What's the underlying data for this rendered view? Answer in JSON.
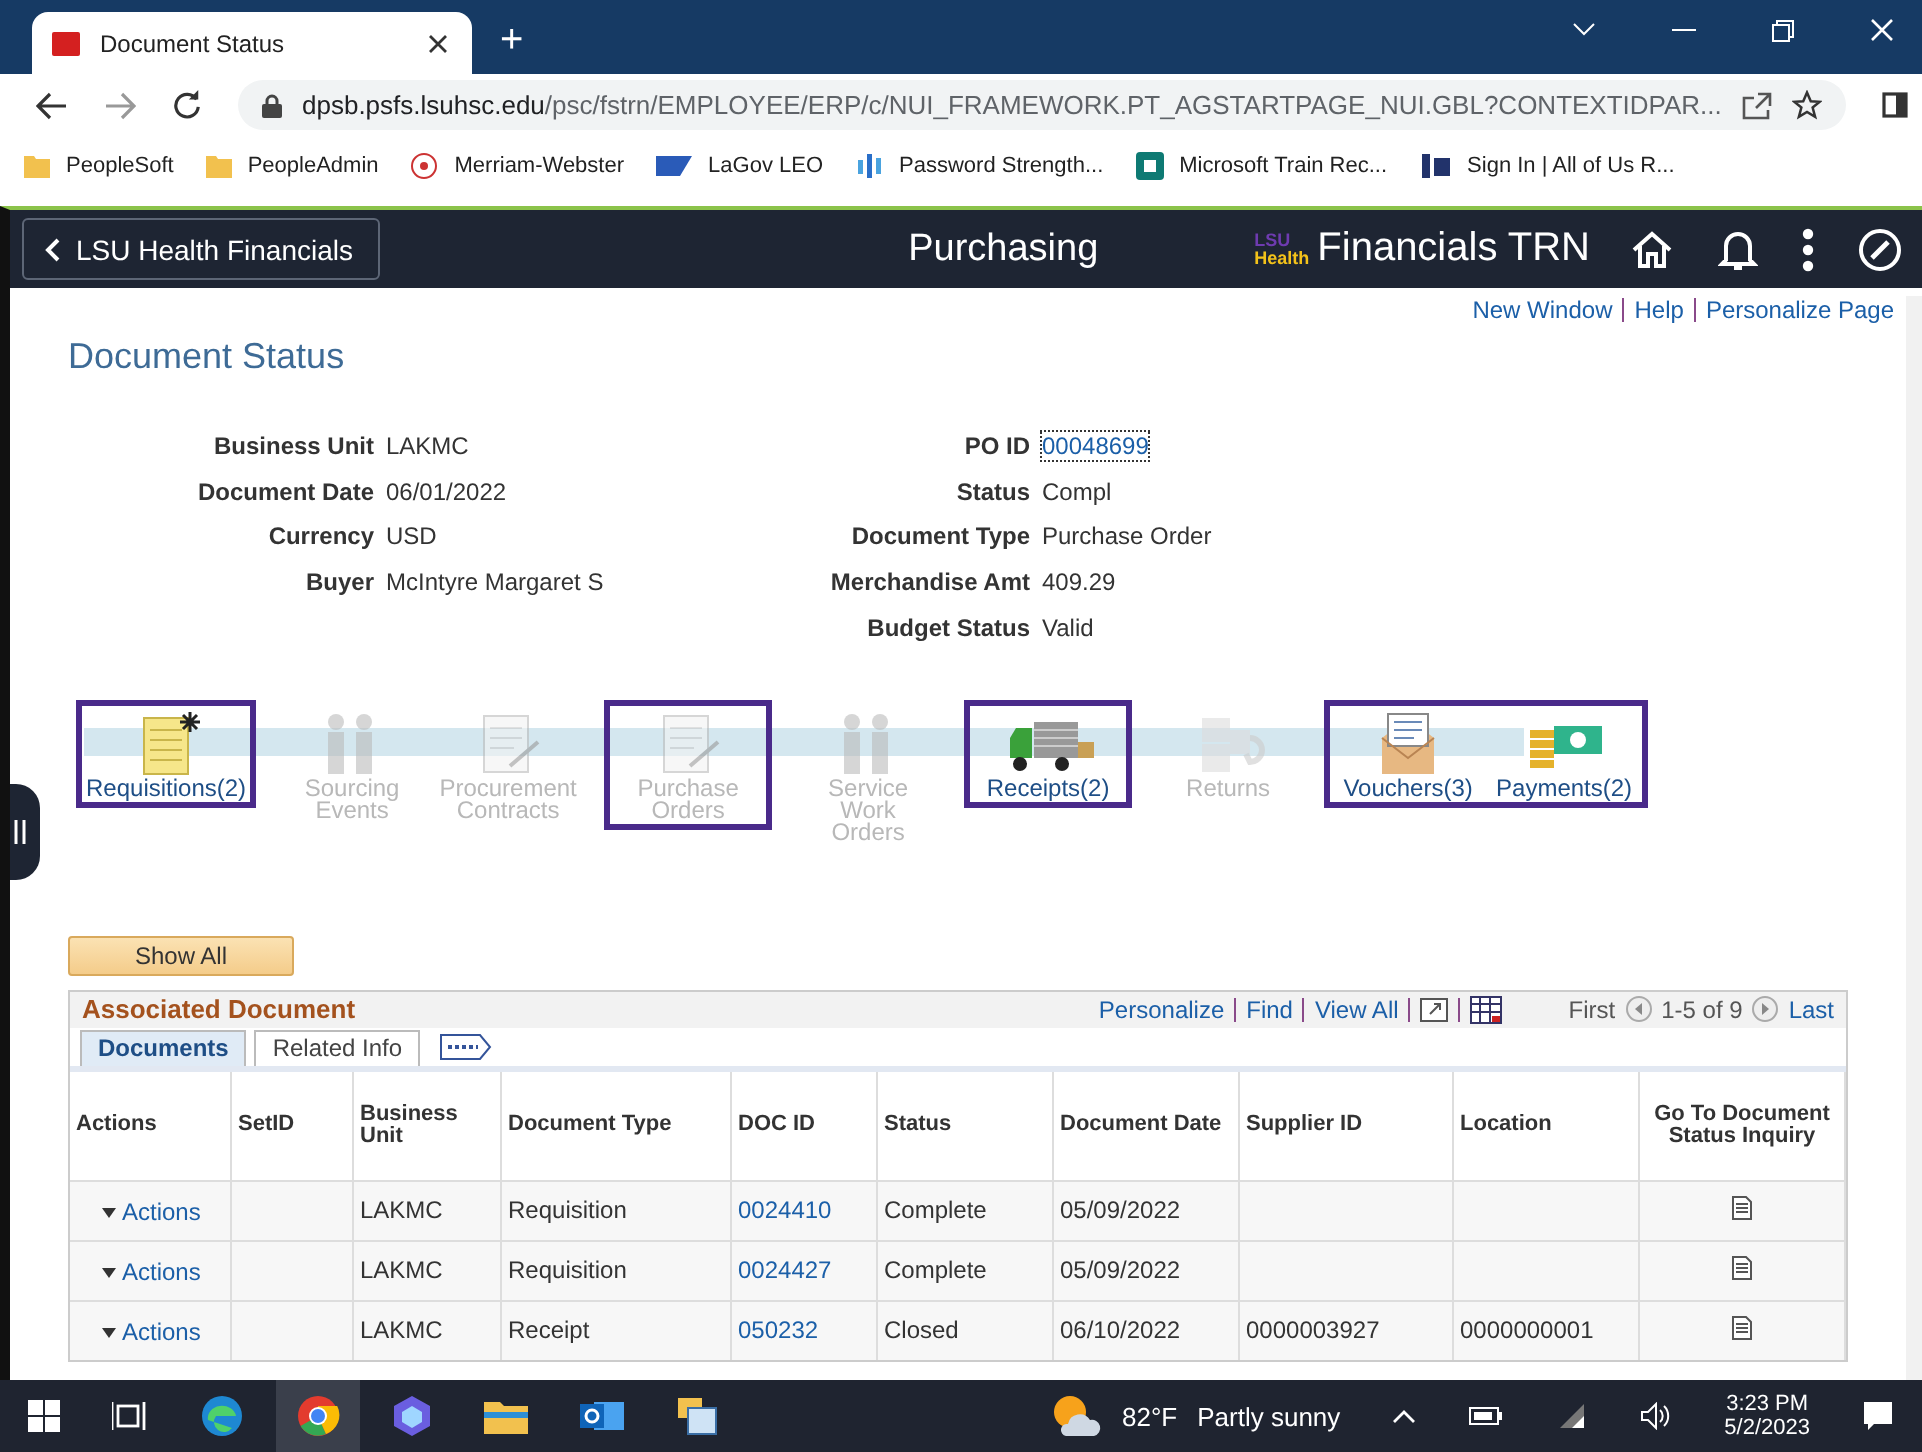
{
  "browser": {
    "tab_title": "Document Status",
    "new_tab": "+",
    "url_host": "dpsb.psfs.lsuhsc.edu",
    "url_path": "/psc/fstrn/EMPLOYEE/ERP/c/NUI_FRAMEWORK.PT_AGSTARTPAGE_NUI.GBL?CONTEXTIDPAR...",
    "bookmarks": [
      {
        "label": "PeopleSoft",
        "kind": "folder"
      },
      {
        "label": "PeopleAdmin",
        "kind": "folder"
      },
      {
        "label": "Merriam-Webster",
        "kind": "mw"
      },
      {
        "label": "LaGov LEO",
        "kind": "sap"
      },
      {
        "label": "Password Strength...",
        "kind": "bars"
      },
      {
        "label": "Microsoft Train Rec...",
        "kind": "sharepoint"
      },
      {
        "label": "Sign In | All of Us R...",
        "kind": "allus"
      }
    ]
  },
  "header": {
    "back": "LSU Health Financials",
    "title": "Purchasing",
    "logo_top": "LSU",
    "logo_bottom": "Health",
    "brand": "Financials TRN"
  },
  "page_links": [
    "New Window",
    "Help",
    "Personalize Page"
  ],
  "page_title": "Document Status",
  "left_fields": [
    {
      "label": "Business Unit",
      "value": "LAKMC"
    },
    {
      "label": "Document Date",
      "value": "06/01/2022"
    },
    {
      "label": "Currency",
      "value": "USD"
    },
    {
      "label": "Buyer",
      "value": "McIntyre Margaret S"
    }
  ],
  "right_fields": [
    {
      "label": "PO ID",
      "value": "00048699",
      "kind": "link"
    },
    {
      "label": "Status",
      "value": "Compl",
      "kind": "text"
    },
    {
      "label": "Document Type",
      "value": "Purchase Order",
      "kind": "text"
    },
    {
      "label": "Merchandise Amt",
      "value": "409.29",
      "kind": "text"
    },
    {
      "label": "Budget Status",
      "value": "Valid",
      "kind": "text"
    }
  ],
  "flow": [
    {
      "highlighted": true,
      "steps": [
        {
          "label": "Requisitions(2)",
          "kind": "requisition",
          "enabled": true
        }
      ]
    },
    {
      "highlighted": false,
      "steps": [
        {
          "label": "Sourcing Events",
          "kind": "sourcing",
          "enabled": false
        },
        {
          "label": "Procurement Contracts",
          "kind": "contract",
          "enabled": false
        }
      ]
    },
    {
      "highlighted": true,
      "steps": [
        {
          "label": "Purchase Orders",
          "kind": "po",
          "enabled": false
        }
      ]
    },
    {
      "highlighted": false,
      "steps": [
        {
          "label": "Service Work Orders",
          "kind": "service",
          "enabled": false
        }
      ]
    },
    {
      "highlighted": true,
      "steps": [
        {
          "label": "Receipts(2)",
          "kind": "truck",
          "enabled": true
        }
      ]
    },
    {
      "highlighted": false,
      "steps": [
        {
          "label": "Returns",
          "kind": "returns",
          "enabled": false
        }
      ]
    },
    {
      "highlighted": true,
      "steps": [
        {
          "label": "Vouchers(3)",
          "kind": "voucher",
          "enabled": true
        },
        {
          "label": "Payments(2)",
          "kind": "payment",
          "enabled": true
        }
      ]
    }
  ],
  "show_all": "Show All",
  "grid": {
    "title": "Associated Document",
    "links": [
      "Personalize",
      "Find",
      "View All"
    ],
    "first": "First",
    "range": "1-5 of 9",
    "last": "Last",
    "tabs": [
      {
        "label": "Documents",
        "selected": true
      },
      {
        "label": "Related Info",
        "selected": false
      }
    ],
    "columns": [
      "Actions",
      "SetID",
      "Business Unit",
      "Document Type",
      "DOC ID",
      "Status",
      "Document Date",
      "Supplier ID",
      "Location",
      "Go To Document Status Inquiry"
    ],
    "rows": [
      {
        "actions": "Actions",
        "setid": "",
        "bu": "LAKMC",
        "type": "Requisition",
        "doc_id": "0024410",
        "status": "Complete",
        "date": "05/09/2022",
        "supplier": "",
        "location": ""
      },
      {
        "actions": "Actions",
        "setid": "",
        "bu": "LAKMC",
        "type": "Requisition",
        "doc_id": "0024427",
        "status": "Complete",
        "date": "05/09/2022",
        "supplier": "",
        "location": ""
      },
      {
        "actions": "Actions",
        "setid": "",
        "bu": "LAKMC",
        "type": "Receipt",
        "doc_id": "050232",
        "status": "Closed",
        "date": "06/10/2022",
        "supplier": "0000003927",
        "location": "0000000001"
      }
    ]
  },
  "taskbar": {
    "temperature": "82°F",
    "weather": "Partly sunny",
    "time": "3:23 PM",
    "date": "5/2/2023"
  }
}
